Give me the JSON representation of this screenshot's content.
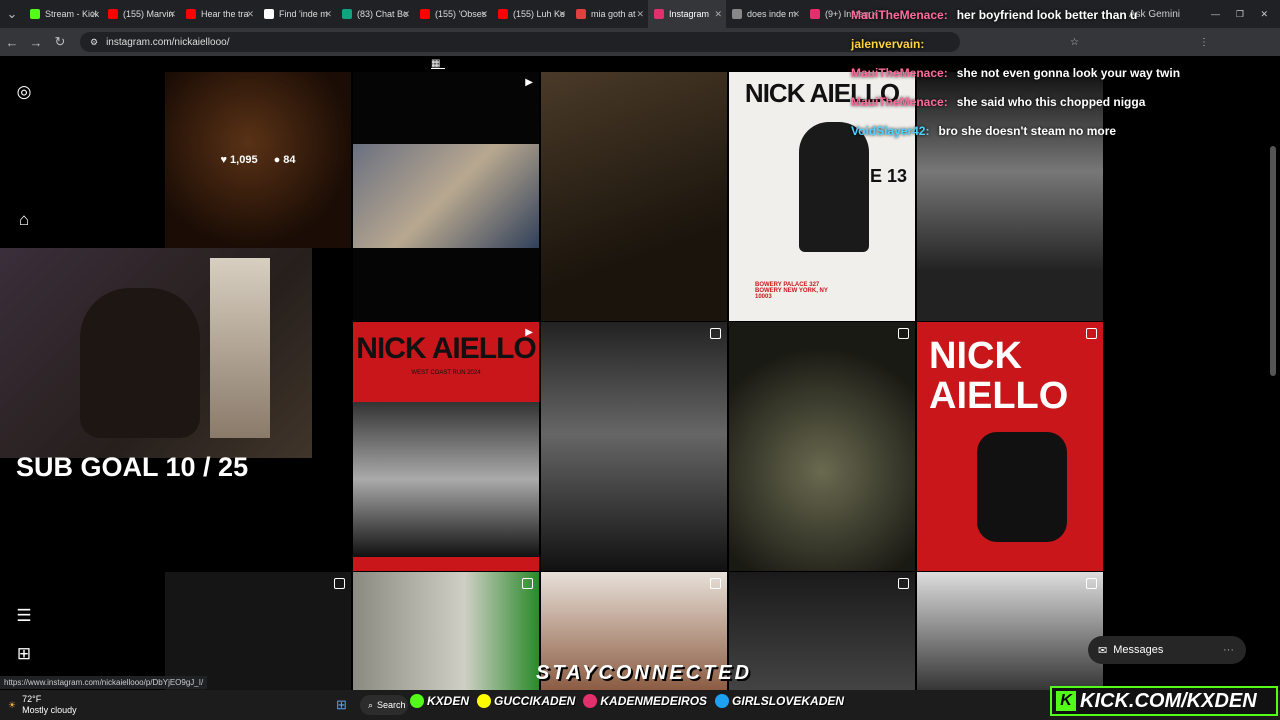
{
  "browser": {
    "tabs": [
      {
        "label": "Stream - Kick",
        "color": "#53fc18"
      },
      {
        "label": "(155) Marvin",
        "color": "#ff0000"
      },
      {
        "label": "Hear the tra",
        "color": "#ff0000"
      },
      {
        "label": "Find 'inde m",
        "color": "#ffffff"
      },
      {
        "label": "(83) Chat Bo",
        "color": "#10a37f"
      },
      {
        "label": "(155) 'Obses",
        "color": "#ff0000"
      },
      {
        "label": "(155) Luh Ke",
        "color": "#ff0000"
      },
      {
        "label": "mia goth at",
        "color": "#e04040"
      },
      {
        "label": "Instagram",
        "color": "#e1306c"
      },
      {
        "label": "does inde m",
        "color": "#888888"
      },
      {
        "label": "(9+) Instagr",
        "color": "#e1306c"
      }
    ],
    "ask_gemini": "Ask Gemini",
    "url": "instagram.com/nickaiellooo/",
    "status_url": "https://www.instagram.com/nickaiellooo/p/DbYjEO9gJ_I/"
  },
  "instagram": {
    "hover_likes": "1,095",
    "hover_comments": "84",
    "messages_label": "Messages",
    "posters": {
      "june_title": "NICK AIELLO",
      "june_date": "JUNE 13",
      "june_venue": "BOWERY PALACE 327 BOWERY NEW YORK, NY 10003",
      "red1_title": "NICK AIELLO",
      "red1_sub": "WEST COAST RUN 2024",
      "red2_title_1": "NICK",
      "red2_title_2": "AIELLO"
    }
  },
  "chat": [
    {
      "user": "MauiTheMenace:",
      "text": "her boyfriend look better than u",
      "color": "#ff6b9d"
    },
    {
      "user": "jalenvervain:",
      "text": "",
      "color": "#ffd23f"
    },
    {
      "user": "MauiTheMenace:",
      "text": "she not even gonna look your way twin",
      "color": "#ff6b9d"
    },
    {
      "user": "MauiTheMenace:",
      "text": "she said who this chopped nigga",
      "color": "#ff6b9d"
    },
    {
      "user": "VoidSlayer42:",
      "text": "bro she doesn't steam no more",
      "color": "#4dd2ff"
    }
  ],
  "overlay": {
    "sub_goal": "SUB GOAL 10 / 25",
    "stay_connected": "STAYCONNECTED",
    "kick_url": "KICK.COM/KXDEN",
    "socials": [
      "KXDEN",
      "GUCCIKADEN",
      "KADENMEDEIROS",
      "GIRLSLOVEKADEN"
    ]
  },
  "taskbar": {
    "temp": "72°F",
    "weather": "Mostly cloudy",
    "search": "Search"
  }
}
